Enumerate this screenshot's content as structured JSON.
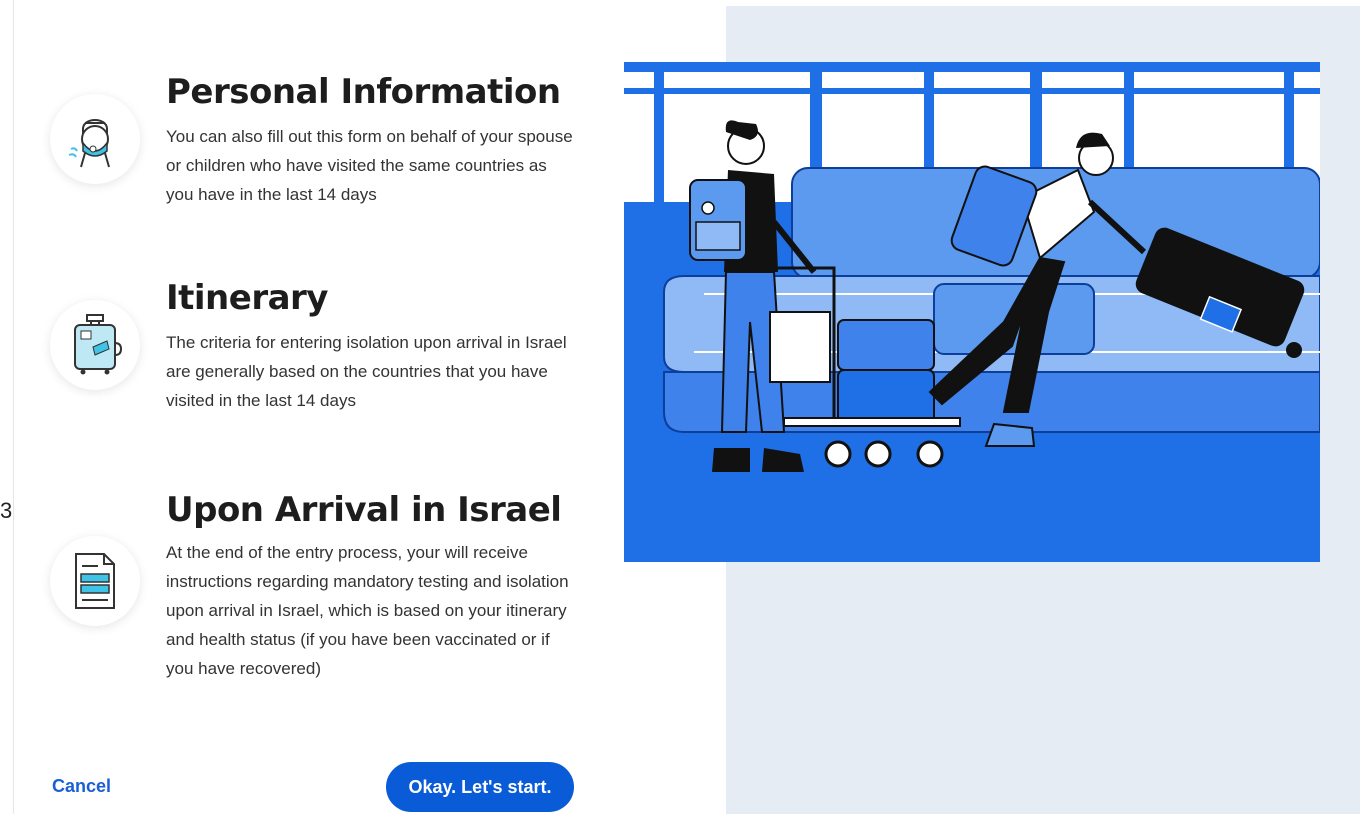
{
  "stray_glyph": "3",
  "sections": [
    {
      "icon": "masked-person-icon",
      "title": "Personal Information",
      "body": "You can also fill out this form on behalf of your spouse or children who have visited the same countries as you have in the last 14 days"
    },
    {
      "icon": "suitcase-icon",
      "title": "Itinerary",
      "body": "The criteria for entering isolation upon arrival in Israel are generally based on the countries that you have visited in the last 14 days"
    },
    {
      "icon": "document-icon",
      "title": "Upon Arrival in Israel",
      "body": "At the end of the entry process, your will receive instructions regarding mandatory testing and isolation upon arrival in Israel, which is based on your itinerary and health status (if you have been vaccinated or if you have recovered)"
    }
  ],
  "actions": {
    "cancel_label": "Cancel",
    "start_label": "Okay. Let's start."
  },
  "colors": {
    "accent": "#0a5bd8",
    "illustration_blue": "#1f6fe6",
    "panel_bg": "#e6ecf4"
  }
}
